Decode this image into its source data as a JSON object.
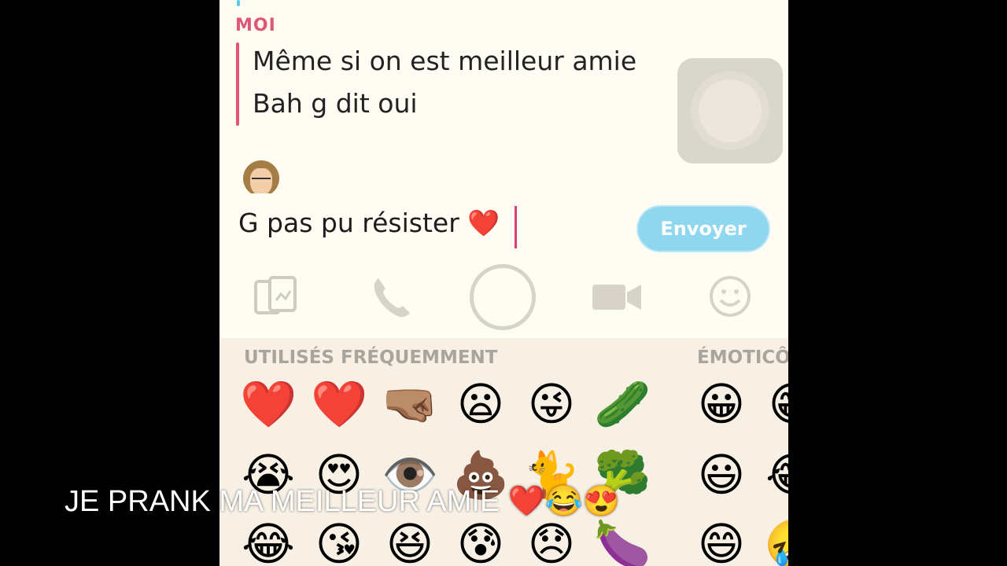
{
  "chat": {
    "sender": "MOI",
    "messages": [
      "Même si on est meilleur amie",
      "Bah g dit oui"
    ]
  },
  "composer": {
    "text": "G pas pu résister ❤️",
    "send_label": "Envoyer"
  },
  "toolbar": {
    "icons": [
      "sticker-icon",
      "phone-icon",
      "capture-icon",
      "video-icon",
      "smiley-icon"
    ]
  },
  "emoji_keyboard": {
    "frequent_title": "UTILISÉS FRÉQUEMMENT",
    "emoticons_title": "ÉMOTICÔNES",
    "rows": [
      [
        "❤️",
        "❤️",
        "🤜🏽",
        "😦",
        "😜",
        "🥒",
        "😀",
        "😁"
      ],
      [
        "😭",
        "😍",
        "👁️",
        "💩",
        "🐈",
        "🥦",
        "😃",
        "😂"
      ],
      [
        "😂",
        "😘",
        "😆",
        "😰",
        "😞",
        "🍆",
        "😄",
        "🤣"
      ]
    ]
  },
  "overlay": {
    "caption": "JE PRANK MA MEILLEUR AMIE ❤️😂😍"
  },
  "colors": {
    "accent_pink": "#e0567a",
    "send_button": "#8fd6ef",
    "background": "#fffdf3",
    "keyboard_bg": "#f8f0e4"
  }
}
